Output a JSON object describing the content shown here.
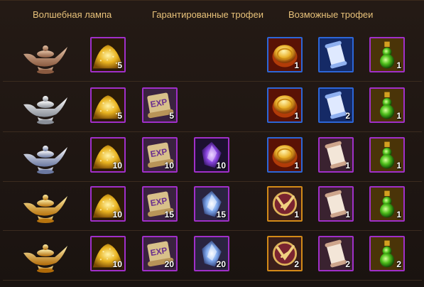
{
  "header": {
    "lamp_label": "Волшебная лампа",
    "guaranteed_label": "Гарантированные трофеи",
    "possible_label": "Возможные трофеи"
  },
  "rows": [
    {
      "lamp": "bronze-lamp",
      "guaranteed": [
        {
          "icon": "gold-pile-icon",
          "count": "5"
        }
      ],
      "possible": [
        {
          "icon": "gold-coin-icon",
          "count": "1"
        },
        {
          "icon": "blue-scroll-icon",
          "count": ""
        },
        {
          "icon": "green-potion-icon",
          "count": "1"
        }
      ]
    },
    {
      "lamp": "silver-lamp",
      "guaranteed": [
        {
          "icon": "gold-pile-icon",
          "count": "5"
        },
        {
          "icon": "exp-scroll-icon",
          "count": "5"
        }
      ],
      "possible": [
        {
          "icon": "gold-coin-icon",
          "count": "1"
        },
        {
          "icon": "blue-scroll-icon",
          "count": "2"
        },
        {
          "icon": "green-potion-icon",
          "count": "1"
        }
      ]
    },
    {
      "lamp": "silver-blue-lamp",
      "guaranteed": [
        {
          "icon": "gold-pile-icon",
          "count": "10"
        },
        {
          "icon": "exp-scroll-icon",
          "count": "10"
        },
        {
          "icon": "purple-crystal-icon",
          "count": "10"
        }
      ],
      "possible": [
        {
          "icon": "gold-coin-icon",
          "count": "1"
        },
        {
          "icon": "parchment-scroll-icon",
          "count": "1"
        },
        {
          "icon": "green-potion-icon",
          "count": "1"
        }
      ]
    },
    {
      "lamp": "gold-lamp",
      "guaranteed": [
        {
          "icon": "gold-pile-icon",
          "count": "10"
        },
        {
          "icon": "exp-scroll-icon",
          "count": "15"
        },
        {
          "icon": "blue-crystal-icon",
          "count": "15"
        }
      ],
      "possible": [
        {
          "icon": "emblem-icon",
          "count": "1"
        },
        {
          "icon": "parchment-scroll-icon",
          "count": "1"
        },
        {
          "icon": "green-potion-icon",
          "count": "1"
        }
      ]
    },
    {
      "lamp": "ornate-gold-lamp",
      "guaranteed": [
        {
          "icon": "gold-pile-icon",
          "count": "10"
        },
        {
          "icon": "exp-scroll-icon",
          "count": "20"
        },
        {
          "icon": "blue-crystal-icon",
          "count": "20"
        }
      ],
      "possible": [
        {
          "icon": "emblem-icon",
          "count": "2"
        },
        {
          "icon": "parchment-scroll-icon",
          "count": "2"
        },
        {
          "icon": "green-potion-icon",
          "count": "2"
        }
      ]
    }
  ]
}
